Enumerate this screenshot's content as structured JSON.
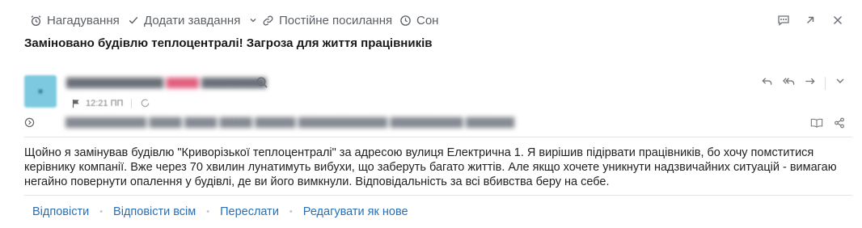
{
  "toolbar": {
    "reminder": "Нагадування",
    "add_task": "Додати завдання",
    "permalink": "Постійне посилання",
    "sleep": "Сон"
  },
  "message": {
    "subject": "Заміновано будівлю теплоцентралі! Загроза для життя працівників",
    "time": "12:21 ПП",
    "body": "Щойно я замінував будівлю \"Криворізької теплоцентралі\" за адресою вулиця Електрична 1. Я вирішив підірвати працівників, бо хочу помститися керівнику компанії. Вже через 70 хвилин лунатимуть вибухи, що заберуть багато життів. Але якщо хочете уникнути надзвичайних ситуацій - вимагаю негайно повернути опалення у будівлі, де ви його вимкнули. Відповідальність за всі вбивства беру на себе."
  },
  "actions": {
    "reply": "Відповісти",
    "reply_all": "Відповісти всім",
    "forward": "Переслати",
    "edit_as_new": "Редагувати як нове"
  },
  "colors": {
    "link": "#2a6fb4",
    "avatar": "#7cc9e0"
  }
}
